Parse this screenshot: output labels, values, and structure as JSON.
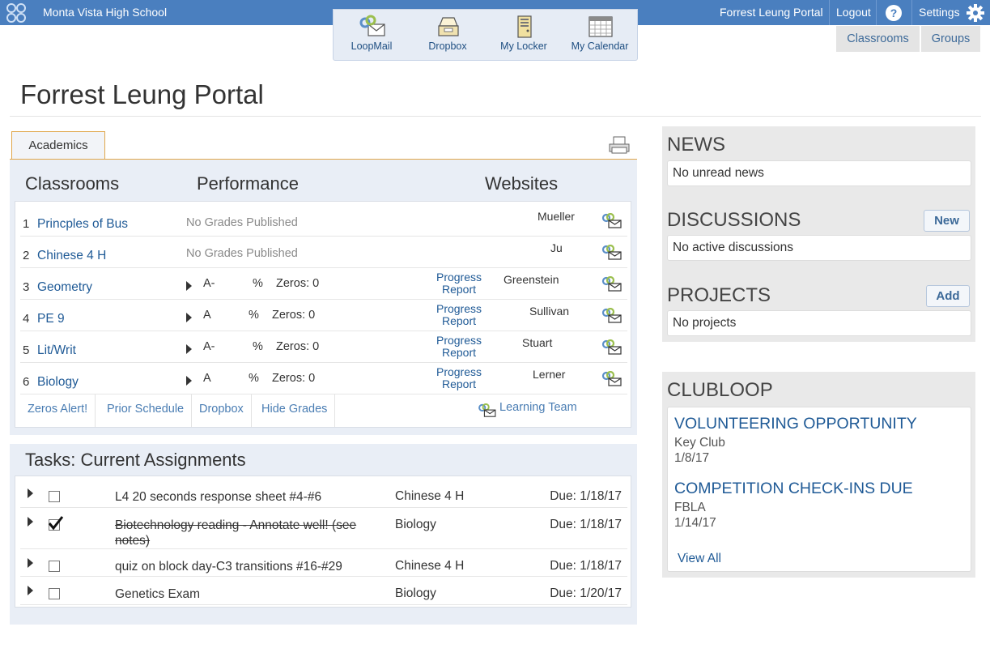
{
  "topbar": {
    "school": "Monta Vista High School",
    "portal_link": "Forrest Leung Portal",
    "logout": "Logout",
    "help": "?",
    "settings": "Settings"
  },
  "apps": [
    {
      "label": "LoopMail",
      "icon": "loopmail-icon"
    },
    {
      "label": "Dropbox",
      "icon": "dropbox-icon"
    },
    {
      "label": "My Locker",
      "icon": "locker-icon"
    },
    {
      "label": "My Calendar",
      "icon": "calendar-icon"
    }
  ],
  "right_tabs": {
    "classrooms": "Classrooms",
    "groups": "Groups"
  },
  "page_title": "Forrest Leung Portal",
  "academics": {
    "tab": "Academics",
    "headers": {
      "classrooms": "Classrooms",
      "performance": "Performance",
      "websites": "Websites"
    },
    "classes": [
      {
        "num": "1",
        "name": "Princples of Bus",
        "no_grades": "No Grades Published",
        "teacher": "Mueller"
      },
      {
        "num": "2",
        "name": "Chinese 4 H",
        "no_grades": "No Grades Published",
        "teacher": "Ju"
      },
      {
        "num": "3",
        "name": "Geometry",
        "grade": "A-",
        "pct": "%",
        "zeros": "Zeros: 0",
        "progress": "Progress Report",
        "teacher": "Greenstein"
      },
      {
        "num": "4",
        "name": "PE 9",
        "grade": "A",
        "pct": "%",
        "zeros": "Zeros: 0",
        "progress": "Progress Report",
        "teacher": "Sullivan"
      },
      {
        "num": "5",
        "name": "Lit/Writ",
        "grade": "A-",
        "pct": "%",
        "zeros": "Zeros: 0",
        "progress": "Progress Report",
        "teacher": "Stuart"
      },
      {
        "num": "6",
        "name": "Biology",
        "grade": "A",
        "pct": "%",
        "zeros": "Zeros: 0",
        "progress": "Progress Report",
        "teacher": "Lerner"
      }
    ],
    "actions": {
      "zeros_alert": "Zeros Alert!",
      "prior_schedule": "Prior Schedule",
      "dropbox": "Dropbox",
      "hide_grades": "Hide Grades",
      "learning_team": "Learning Team"
    }
  },
  "tasks": {
    "title": "Tasks: Current Assignments",
    "items": [
      {
        "name": "L4 20 seconds response sheet #4-#6",
        "class": "Chinese 4 H",
        "due": "Due: 1/18/17",
        "done": false
      },
      {
        "name": "Biotechnology reading - Annotate well! (see notes)",
        "class": "Biology",
        "due": "Due: 1/18/17",
        "done": true
      },
      {
        "name": "quiz on block day-C3 transitions #16-#29",
        "class": "Chinese 4 H",
        "due": "Due: 1/18/17",
        "done": false
      },
      {
        "name": "Genetics Exam",
        "class": "Biology",
        "due": "Due: 1/20/17",
        "done": false
      }
    ]
  },
  "news": {
    "title": "NEWS",
    "empty": "No unread news"
  },
  "discussions": {
    "title": "DISCUSSIONS",
    "button": "New",
    "empty": "No active discussions"
  },
  "projects": {
    "title": "PROJECTS",
    "button": "Add",
    "empty": "No projects"
  },
  "clubloop": {
    "title": "CLUBLOOP",
    "items": [
      {
        "title": "VOLUNTEERING OPPORTUNITY",
        "club": "Key Club",
        "date": "1/8/17"
      },
      {
        "title": "COMPETITION CHECK-INS DUE",
        "club": "FBLA",
        "date": "1/14/17"
      }
    ],
    "view_all": "View All"
  },
  "colors": {
    "topbar": "#4a7fbf",
    "link": "#1f5a96",
    "panel": "#e9eef6",
    "accent": "#e0a64a"
  }
}
